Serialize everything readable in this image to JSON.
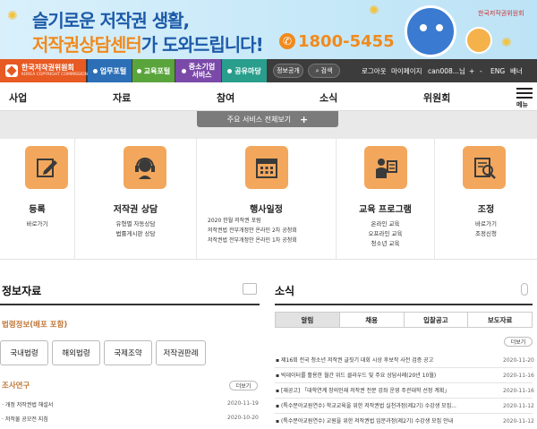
{
  "banner": {
    "line1": "슬기로운 저작권 생활,",
    "line2_highlight": "저작권상담센터",
    "line2_rest": "가 도와드립니다!",
    "phone": "1800-5455",
    "logo_text": "한국저작권위원회"
  },
  "topbar": {
    "logo_title": "한국저작권위원회",
    "logo_sub": "KOREA COPYRIGHT COMMISSION",
    "portals": [
      "업무포털",
      "교육포털",
      "중소기업 서비스",
      "공유마당"
    ],
    "info_label": "정보공개",
    "search_label": "검색",
    "util": [
      "로그아웃",
      "마이페이지",
      "can008...님",
      "+",
      "-",
      "ENG",
      "배너"
    ]
  },
  "mainnav": {
    "items": [
      "사업",
      "자료",
      "참여",
      "소식",
      "위원회"
    ],
    "menu_label": "메뉴"
  },
  "services_bar": {
    "label": "주요 서비스 전체보기"
  },
  "services": [
    {
      "title": "등록",
      "lines": [
        "바로가기"
      ]
    },
    {
      "title": "저작권 상담",
      "lines": [
        "유형별 자동상담",
        "법률게시판 상담"
      ]
    },
    {
      "title": "행사일정",
      "lines": [
        "2020 한월 저작권 포럼",
        "저작권법 전부개정안 온라인 2차 공청회",
        "저작권법 전부개정안 온라인 1차 공청회"
      ]
    },
    {
      "title": "교육 프로그램",
      "lines": [
        "온라인 교육",
        "오프라인 교육",
        "청소년 교육"
      ]
    },
    {
      "title": "조정",
      "lines": [
        "바로가기",
        "조정신청"
      ]
    }
  ],
  "info": {
    "title": "정보자료",
    "law_head": "법령정보(배포 포함)",
    "law_buttons": [
      "국내법령",
      "해외법령",
      "국제조약",
      "저작권판례"
    ],
    "research_head": "조사연구",
    "more_label": "더보기",
    "items": [
      {
        "text": "개정 저작권법 해설서",
        "date": "2020-11-19"
      },
      {
        "text": "저작물 공모전 지침",
        "date": "2020-10-20"
      }
    ]
  },
  "news": {
    "title": "소식",
    "tabs": [
      "알림",
      "채용",
      "입찰공고",
      "보도자료"
    ],
    "more_label": "더보기",
    "items": [
      {
        "text": "제16회 전국 청소년 저작권 글짓기 대회 시상 후보작 사전 검증 공고",
        "date": "2020-11-20"
      },
      {
        "text": "빅데이터를 활용한 월간 위드 클라우드 및 주요 상담사례(20년 10월)",
        "date": "2020-11-16"
      },
      {
        "text": "[재공고] 「대학연계 창의인재 저작권 전문 강좌 운영 주관대학 선정 계획」",
        "date": "2020-11-16"
      },
      {
        "text": "(특수분야교원연수) 학교교육을 위한 저작권법 실천과정(제2기) 수강생 모집...",
        "date": "2020-11-12"
      },
      {
        "text": "(특수분야교원연수) 교원을 위한 저작권법 입문과정(제2기) 수강생 모집 안내",
        "date": "2020-11-12"
      }
    ]
  },
  "colors": {
    "accent": "#e85a23",
    "icon_bg": "#f2a75c",
    "topbar": "#3c3c3c"
  }
}
